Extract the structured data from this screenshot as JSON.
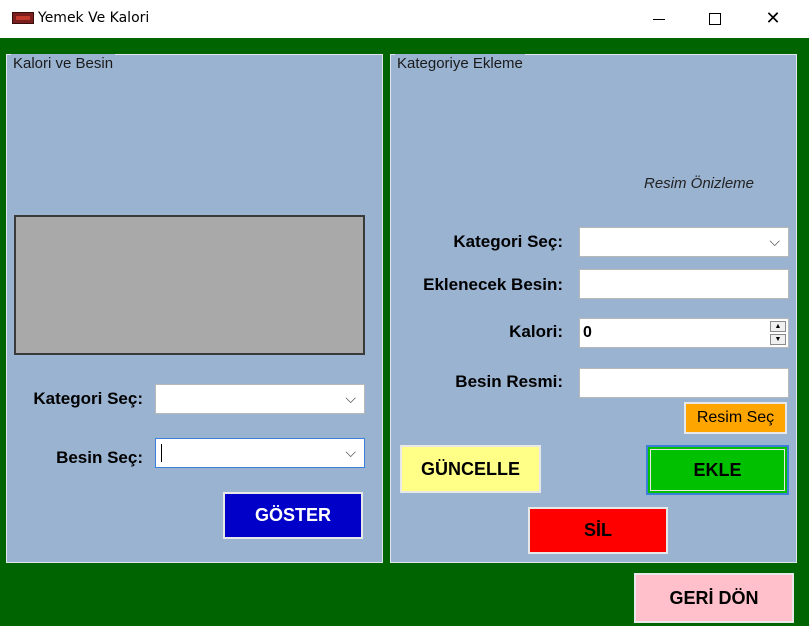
{
  "window": {
    "title": "Yemek Ve Kalori",
    "icon": "app-icon",
    "minimize_icon": "minimize-icon",
    "maximize_icon": "maximize-icon",
    "close_icon": "close-icon"
  },
  "colors": {
    "background": "#006400",
    "group": "#9ab3d1",
    "goster": "#0000c8",
    "guncelle": "#ffff88",
    "ekle": "#00c000",
    "sil": "#ff0000",
    "resim_sec": "#ffa500",
    "geri_don": "#ffc0cb"
  },
  "left_group": {
    "caption": "Kalori ve Besin",
    "kategori_label": "Kategori Seç:",
    "kategori_value": "",
    "besin_label": "Besin Seç:",
    "besin_value": "",
    "goster_label": "GÖSTER"
  },
  "right_group": {
    "caption": "Kategoriye Ekleme",
    "preview_text": "Resim Önizleme",
    "kategori_label": "Kategori Seç:",
    "kategori_value": "",
    "eklenecek_label": "Eklenecek Besin:",
    "eklenecek_value": "",
    "kalori_label": "Kalori:",
    "kalori_value": "0",
    "resim_label": "Besin Resmi:",
    "resim_value": "",
    "resim_sec_label": "Resim Seç",
    "guncelle_label": "GÜNCELLE",
    "ekle_label": "EKLE",
    "sil_label": "SİL"
  },
  "footer": {
    "geri_don_label": "GERİ DÖN"
  }
}
